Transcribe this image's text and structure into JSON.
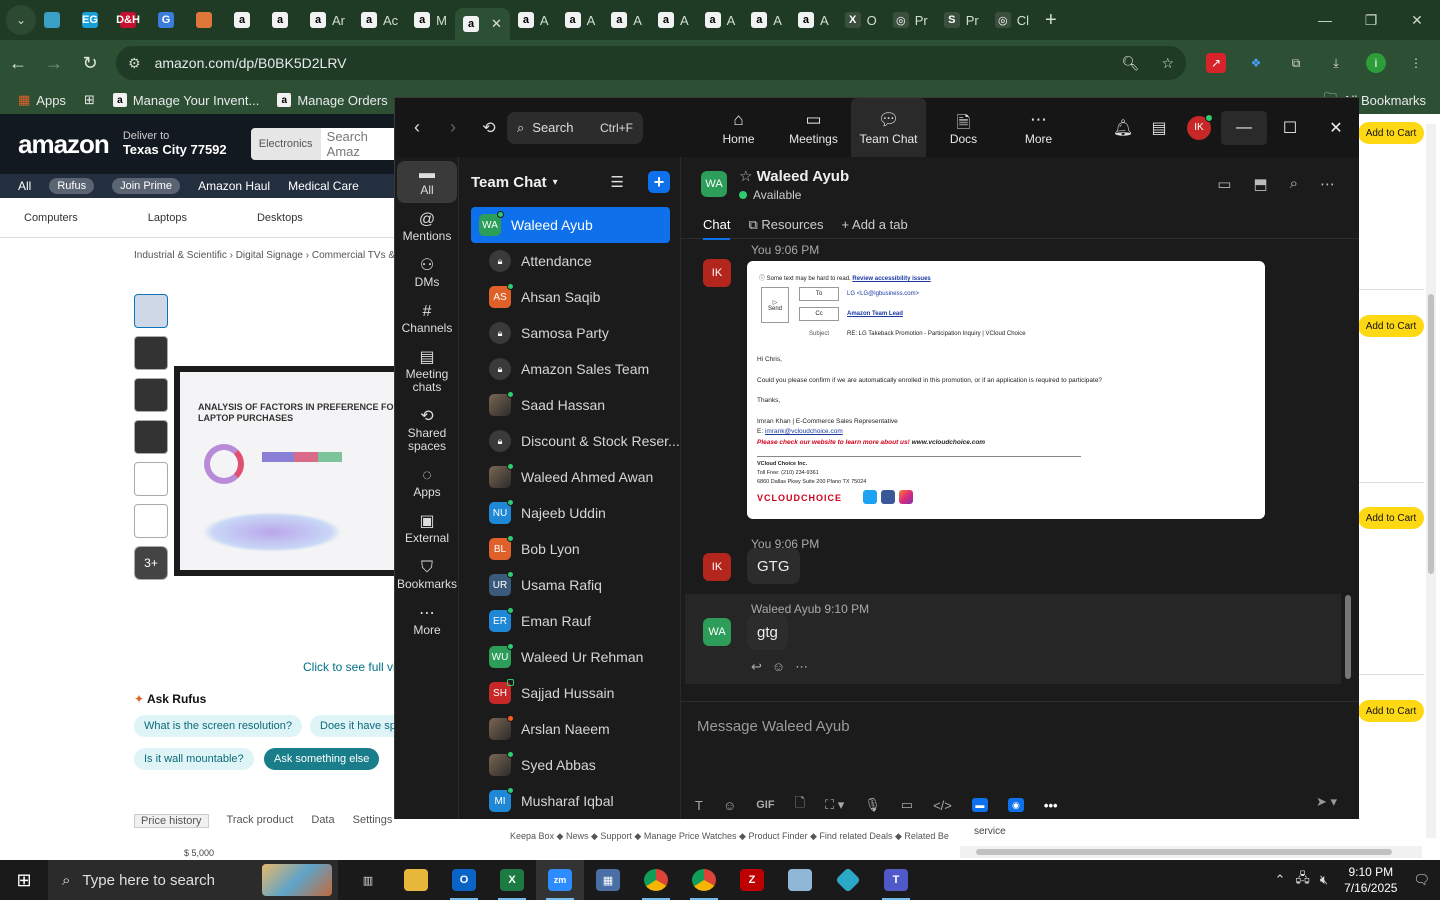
{
  "browser": {
    "tabs": [
      {
        "label": "",
        "icon": "chevron-down-icon"
      },
      {
        "label": "",
        "icon": "diamond-icon",
        "color": "#3aa0c8"
      },
      {
        "label": "",
        "icon": "eg-icon",
        "text": "EG",
        "color": "#1aa0d8"
      },
      {
        "label": "",
        "icon": "red-badge-icon",
        "text": "D&H",
        "color": "#c8102e"
      },
      {
        "label": "",
        "icon": "g-icon",
        "text": "G",
        "color": "#3b7ddd"
      },
      {
        "label": "",
        "icon": "cube-icon",
        "color": "#e0773a"
      },
      {
        "label": "",
        "icon": "amazon-icon",
        "text": "a"
      },
      {
        "label": "",
        "icon": "amazon-icon",
        "text": "a"
      },
      {
        "label": "Ar",
        "icon": "amazon-icon",
        "text": "a"
      },
      {
        "label": "Ac",
        "icon": "amazon-icon",
        "text": "a"
      },
      {
        "label": "M",
        "icon": "amazon-icon",
        "text": "a"
      },
      {
        "label": "",
        "icon": "amazon-icon",
        "text": "a",
        "active": true
      },
      {
        "label": "A",
        "icon": "amazon-icon",
        "text": "a"
      },
      {
        "label": "A",
        "icon": "amazon-icon",
        "text": "a"
      },
      {
        "label": "A",
        "icon": "amazon-icon",
        "text": "a"
      },
      {
        "label": "A",
        "icon": "amazon-icon",
        "text": "a"
      },
      {
        "label": "A",
        "icon": "amazon-icon",
        "text": "a"
      },
      {
        "label": "A",
        "icon": "amazon-icon",
        "text": "a"
      },
      {
        "label": "A",
        "icon": "amazon-icon",
        "text": "a"
      },
      {
        "label": "O",
        "icon": "excel-icon",
        "text": "X"
      },
      {
        "label": "Pr",
        "icon": "openai-icon",
        "text": "◎"
      },
      {
        "label": "Pr",
        "icon": "s-icon",
        "text": "S"
      },
      {
        "label": "Cl",
        "icon": "openai-icon",
        "text": "◎"
      }
    ],
    "new_tab": "+",
    "url": "amazon.com/dp/B0BK5D2LRV",
    "bookmarks": [
      {
        "label": "Apps",
        "icon": "apps-grid-icon"
      },
      {
        "label": "",
        "icon": "grid-icon"
      },
      {
        "label": "Manage Your Invent...",
        "icon": "amazon-icon"
      },
      {
        "label": "Manage Orders",
        "icon": "amazon-icon"
      }
    ],
    "all_bookmarks": "All Bookmarks"
  },
  "amazon": {
    "logo": "amazon",
    "deliver_to": "Deliver to",
    "location": "Texas City 77592",
    "search_category": "Electronics",
    "search_placeholder": "Search Amaz",
    "nav": [
      "All",
      "Rufus",
      "Join Prime",
      "Amazon Haul",
      "Medical Care"
    ],
    "subnav": [
      "Computers",
      "Laptops",
      "Desktops"
    ],
    "breadcrumb": "Industrial & Scientific › Digital Signage › Commercial TVs &",
    "thumb_more": "3+",
    "screen_title": "ANALYSIS OF FACTORS IN PREFERENCE FOR LAPTOP PURCHASES",
    "click_full": "Click to see full vi",
    "ask_rufus": "Ask Rufus",
    "questions": [
      "What is the screen resolution?",
      "Does it have sp",
      "Is it wall mountable?",
      "Ask something else"
    ],
    "bottom_tabs": [
      "Price history",
      "Track product",
      "Data",
      "Settings"
    ],
    "footer": "Keepa Box  ◆  News  ◆  Support  ◆  Manage Price Watches  ◆  Product Finder  ◆  Find related Deals  ◆  Related Be",
    "price": "$ 5,000",
    "add_to_cart": "Add to Cart",
    "service": "service"
  },
  "zoom": {
    "search_label": "Search",
    "search_shortcut": "Ctrl+F",
    "top_tabs": [
      {
        "label": "Home",
        "icon": "home-icon"
      },
      {
        "label": "Meetings",
        "icon": "video-icon"
      },
      {
        "label": "Team Chat",
        "icon": "chat-icon",
        "active": true
      },
      {
        "label": "Docs",
        "icon": "docs-icon"
      },
      {
        "label": "More",
        "icon": "more-icon"
      }
    ],
    "user_initials": "IK",
    "rail": [
      {
        "label": "All",
        "icon": "chat-bubble-icon",
        "active": true
      },
      {
        "label": "Mentions",
        "icon": "at-icon"
      },
      {
        "label": "DMs",
        "icon": "people-icon"
      },
      {
        "label": "Channels",
        "icon": "hash-icon"
      },
      {
        "label": "Meeting chats",
        "icon": "calendar-icon"
      },
      {
        "label": "Shared spaces",
        "icon": "share-icon"
      },
      {
        "label": "Apps",
        "icon": "apps-icon"
      },
      {
        "label": "External",
        "icon": "building-icon"
      },
      {
        "label": "Bookmarks",
        "icon": "bookmark-icon"
      },
      {
        "label": "More",
        "icon": "ellipsis-icon"
      }
    ],
    "list_title": "Team Chat",
    "chats": [
      {
        "name": "Waleed Ayub",
        "initials": "WA",
        "color": "#2d9d5a",
        "selected": true,
        "status": "green"
      },
      {
        "name": "Attendance",
        "type": "lock"
      },
      {
        "name": "Ahsan Saqib",
        "initials": "AS",
        "color": "#e0602a",
        "status": "green"
      },
      {
        "name": "Samosa Party",
        "type": "lock"
      },
      {
        "name": "Amazon Sales Team",
        "type": "lock"
      },
      {
        "name": "Saad Hassan",
        "type": "photo",
        "status": "green"
      },
      {
        "name": "Discount & Stock Reser...",
        "type": "lock"
      },
      {
        "name": "Waleed Ahmed Awan",
        "type": "photo",
        "status": "green"
      },
      {
        "name": "Najeeb Uddin",
        "initials": "NU",
        "color": "#1e88d6",
        "status": "green"
      },
      {
        "name": "Bob Lyon",
        "initials": "BL",
        "color": "#e0602a",
        "status": "green"
      },
      {
        "name": "Usama Rafiq",
        "initials": "UR",
        "color": "#3a5a7a",
        "status": "green"
      },
      {
        "name": "Eman Rauf",
        "initials": "ER",
        "color": "#1e88d6",
        "status": "green"
      },
      {
        "name": "Waleed Ur Rehman",
        "initials": "WU",
        "color": "#2d9d5a",
        "status": "green"
      },
      {
        "name": "Sajjad Hussain",
        "initials": "SH",
        "color": "#c62828",
        "status": "square"
      },
      {
        "name": "Arslan Naeem",
        "type": "photo",
        "status": "red"
      },
      {
        "name": "Syed Abbas",
        "type": "photo",
        "status": "green"
      },
      {
        "name": "Musharaf Iqbal",
        "initials": "MI",
        "color": "#1e88d6",
        "status": "green"
      }
    ],
    "chat": {
      "name": "Waleed Ayub",
      "initials": "WA",
      "status": "Available",
      "tabs": [
        "Chat",
        "Resources",
        "Add a tab"
      ],
      "messages": [
        {
          "sender": "You",
          "time": "9:06 PM",
          "initials": "IK",
          "type": "image"
        },
        {
          "sender": "You",
          "time": "9:06 PM",
          "initials": "IK",
          "text": "GTG"
        },
        {
          "sender": "Waleed Ayub",
          "time": "9:10 PM",
          "initials": "WA",
          "text": "gtg"
        }
      ],
      "email": {
        "warning": "Some text may be hard to read.",
        "warning_link": "Review accessibility issues",
        "send": "Send",
        "to_label": "To",
        "to_value": "LG <LG@lgbusiness.com>",
        "cc_label": "Cc",
        "cc_value": "Amazon Team Lead",
        "subject_label": "Subject",
        "subject": "RE: LG Takeback Promotion - Participation Inquiry | VCloud Choice",
        "greeting": "Hi Chris,",
        "line1": "Could you please confirm if we are automatically enrolled in this promotion, or if an application is required to participate?",
        "thanks": "Thanks,",
        "sign_name": "Imran Khan | E-Commerce Sales Representative",
        "sign_email_label": "E:",
        "sign_email": "imrank@vcloudchoice.com",
        "promo": "Please check our website to learn more about us!",
        "website": "www.vcloudchoice.com",
        "company": "VCloud Choice Inc.",
        "phone": "Toll Free: (210) 234-9361",
        "address": "6860 Dallas Pkwy Suite 200 Plano TX 75024",
        "logo": "VCLOUDCHOICE"
      },
      "composer_placeholder": "Message Waleed Ayub"
    }
  },
  "taskbar": {
    "search": "Type here to search",
    "time": "9:10 PM",
    "date": "7/16/2025"
  }
}
